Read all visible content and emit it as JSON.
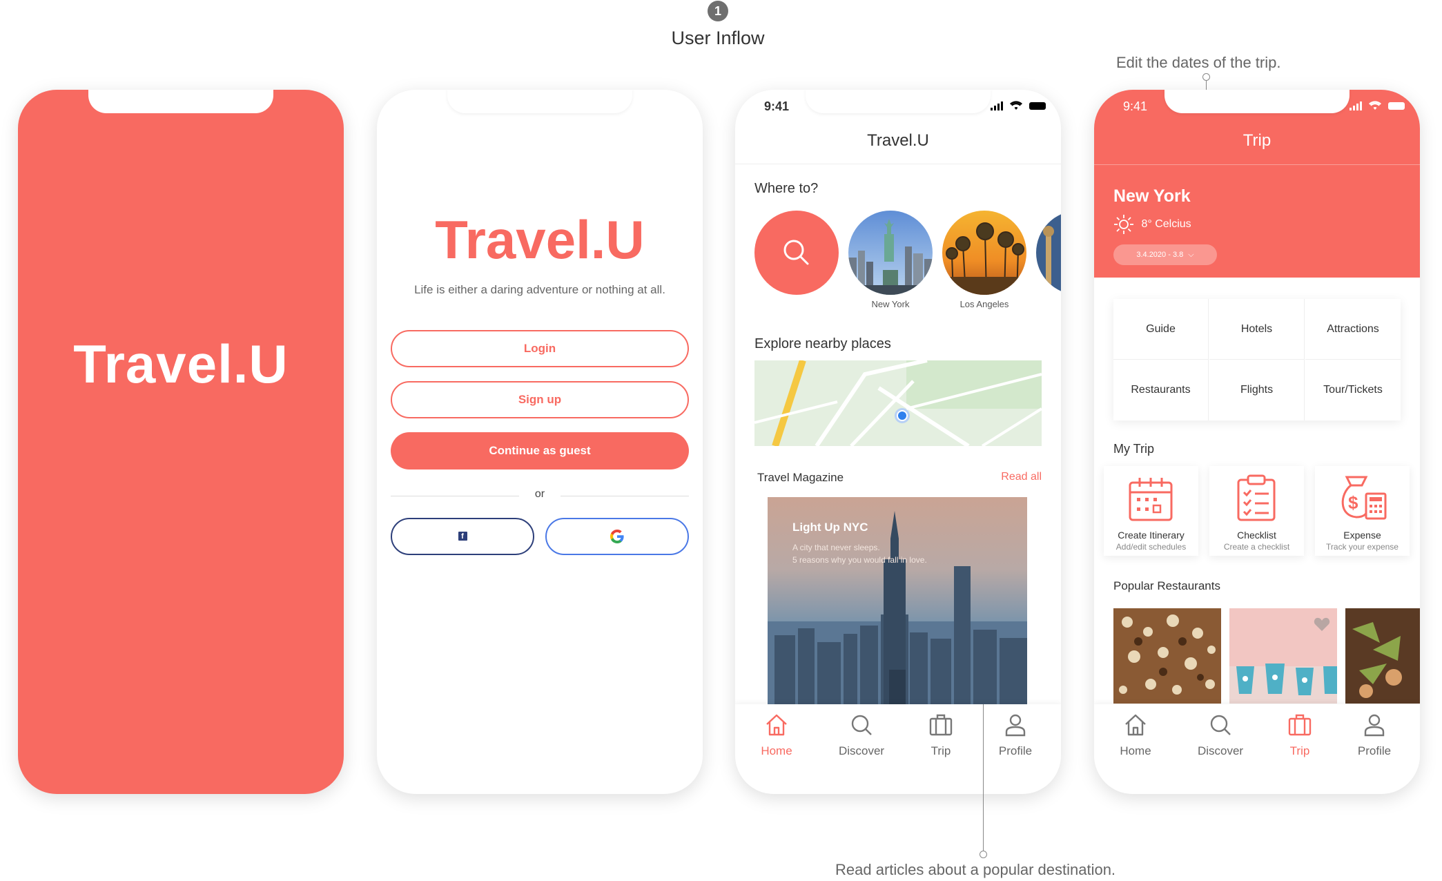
{
  "header": {
    "step": "1",
    "title": "User Inflow"
  },
  "annotations": {
    "top": "Edit the dates of the trip.",
    "bottom": "Read articles about a popular destination."
  },
  "colors": {
    "accent": "#f86a61",
    "facebook": "#2d3f7a",
    "google": "#4285f4"
  },
  "splash": {
    "logo": "Travel.U"
  },
  "login": {
    "logo": "Travel.U",
    "tagline": "Life is either a daring adventure or nothing at all.",
    "login_label": "Login",
    "signup_label": "Sign up",
    "guest_label": "Continue as guest",
    "or": "or",
    "facebook_icon": "f"
  },
  "home": {
    "time": "9:41",
    "title": "Travel.U",
    "where_to": "Where to?",
    "destinations": [
      "New York",
      "Los Angeles"
    ],
    "explore": "Explore nearby places",
    "magazine": "Travel Magazine",
    "read_all": "Read all",
    "article": {
      "title": "Light Up NYC",
      "line1": "A city that never sleeps.",
      "line2": "5 reasons why you would fall in love."
    }
  },
  "trip": {
    "time": "9:41",
    "title": "Trip",
    "city": "New York",
    "weather": "8° Celcius",
    "dates": "3.4.2020 - 3.8",
    "grid": [
      "Guide",
      "Hotels",
      "Attractions",
      "Restaurants",
      "Flights",
      "Tour/Tickets"
    ],
    "my_trip": "My Trip",
    "cards": [
      {
        "title": "Create Itinerary",
        "sub": "Add/edit schedules"
      },
      {
        "title": "Checklist",
        "sub": "Create a checklist"
      },
      {
        "title": "Expense",
        "sub": "Track your expense"
      }
    ],
    "popular": "Popular Restaurants"
  },
  "tabs": [
    "Home",
    "Discover",
    "Trip",
    "Profile"
  ]
}
